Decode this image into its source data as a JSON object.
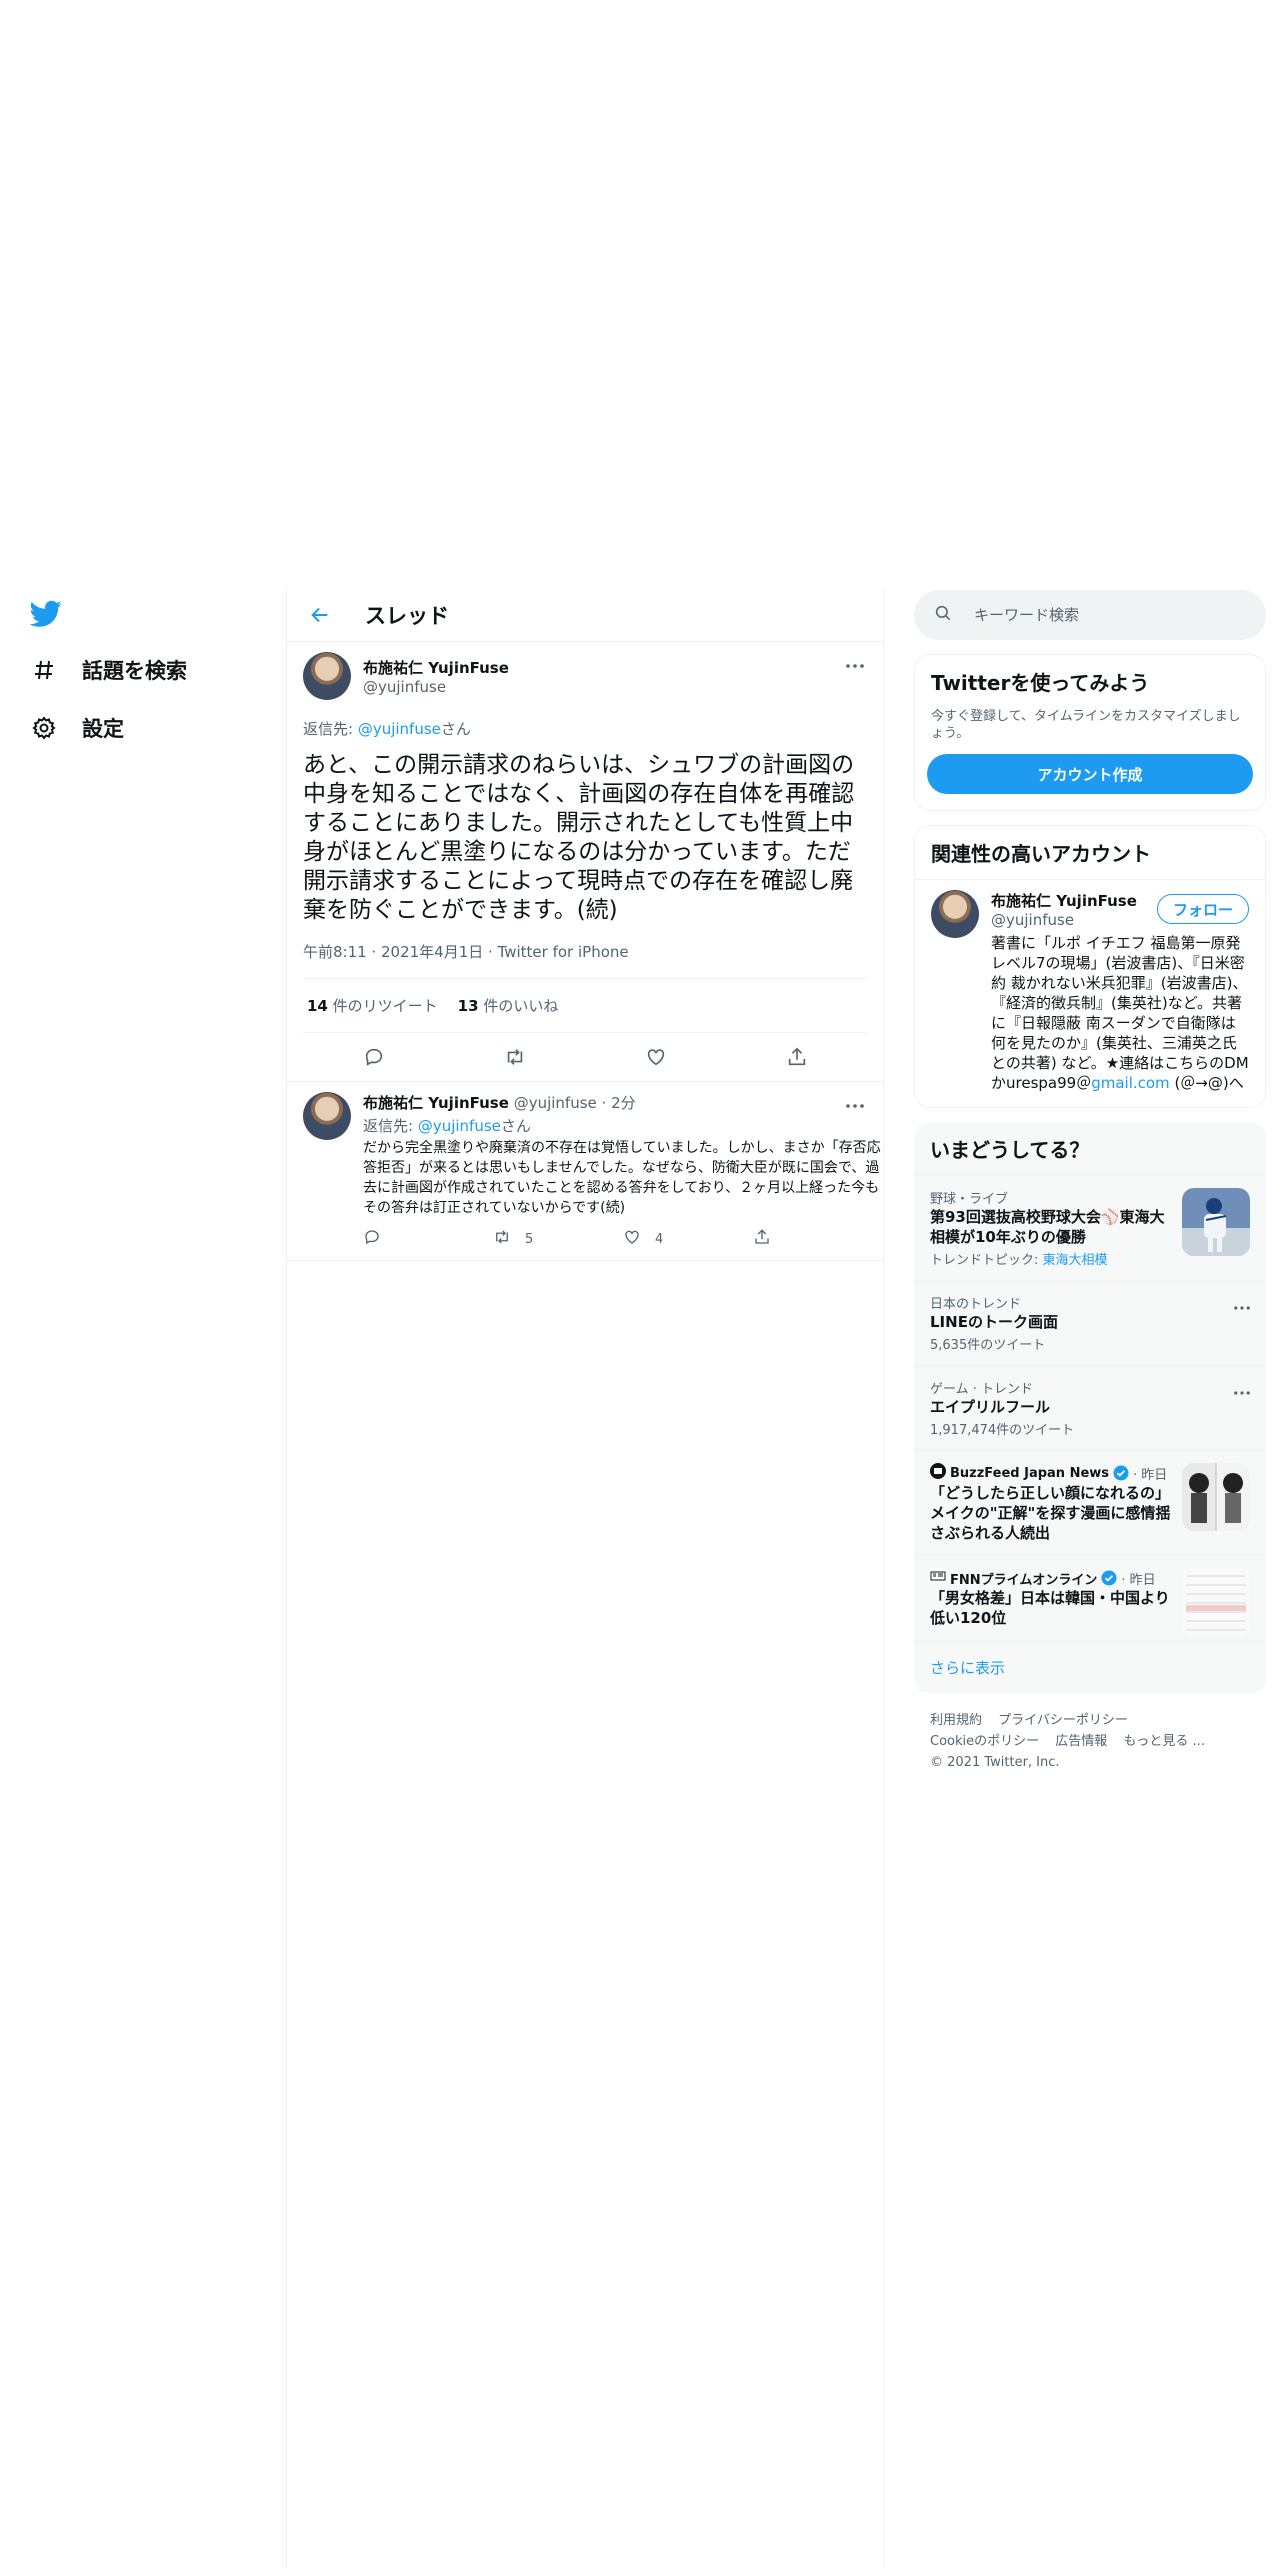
{
  "nav": {
    "explore_label": "話題を検索",
    "settings_label": "設定"
  },
  "header": {
    "title": "スレッド"
  },
  "main_tweet": {
    "display_name": "布施祐仁 YujinFuse",
    "username": "@yujinfuse",
    "replying_prefix": "返信先: ",
    "replying_handle": "@yujinfuse",
    "replying_suffix": "さん",
    "text": "あと、この開示請求のねらいは、シュワブの計画図の中身を知ることではなく、計画図の存在自体を再確認することにありました。開示されたとしても性質上中身がほとんど黒塗りになるのは分かっています。ただ開示請求することによって現時点での存在を確認し廃棄を防ぐことができます。(続)",
    "meta": "午前8:11 · 2021年4月1日 · Twitter for iPhone",
    "retweets": "14",
    "retweets_label": "件のリツイート",
    "likes": "13",
    "likes_label": "件のいいね"
  },
  "reply_tweet": {
    "display_name": "布施祐仁 YujinFuse",
    "meta": "@yujinfuse · 2分",
    "replying_prefix": "返信先: ",
    "replying_handle": "@yujinfuse",
    "replying_suffix": "さん",
    "text": "だから完全黒塗りや廃棄済の不存在は覚悟していました。しかし、まさか「存否応答拒否」が来るとは思いもしませんでした。なぜなら、防衛大臣が既に国会で、過去に計画図が作成されていたことを認める答弁をしており、２ヶ月以上経った今もその答弁は訂正されていないからです(続)",
    "retweets": "5",
    "likes": "4"
  },
  "search": {
    "placeholder": "キーワード検索"
  },
  "signup": {
    "title": "Twitterを使ってみよう",
    "desc": "今すぐ登録して、タイムラインをカスタマイズしましょう。",
    "button": "アカウント作成"
  },
  "related": {
    "title": "関連性の高いアカウント",
    "display_name": "布施祐仁 YujinFuse",
    "username": "@yujinfuse",
    "follow": "フォロー",
    "bio_1": "著書に「ルポ イチエフ 福島第一原発レベル7の現場」(岩波書店)、『日米密約 裁かれない米兵犯罪』(岩波書店)、『経済的徴兵制』(集英社)など。共著に『日報隠蔽 南スーダンで自衛隊は何を見たのか』(集英社、三浦英之氏との共著) など。★連絡はこちらのDMかurespa99＠",
    "bio_link": "gmail.com",
    "bio_2": " (＠→@)へ"
  },
  "trends": {
    "title": "いまどうしてる？",
    "items": [
      {
        "cat": "野球・ライブ",
        "name": "第93回選抜高校野球大会⚾東海大相模が10年ぶりの優勝",
        "topic_prefix": "トレンドトピック: ",
        "topic": "東海大相模"
      },
      {
        "cat": "日本のトレンド",
        "name": "LINEのトーク画面",
        "count": "5,635件のツイート"
      },
      {
        "cat": "ゲーム · トレンド",
        "name": "エイプリルフール",
        "count": "1,917,474件のツイート"
      },
      {
        "source": "BuzzFeed Japan News",
        "time": " · 昨日",
        "name": "「どうしたら正しい顔になれるの」メイクの\"正解\"を探す漫画に感情揺さぶられる人続出"
      },
      {
        "source": "FNNプライムオンライン",
        "time": " · 昨日",
        "name": "「男女格差」日本は韓国・中国より低い120位"
      }
    ],
    "show_more": "さらに表示"
  },
  "footer": {
    "links": [
      "利用規約",
      "プライバシーポリシー",
      "Cookieのポリシー",
      "広告情報",
      "もっと見る ..."
    ],
    "copyright": "© 2021 Twitter, Inc."
  },
  "colors": {
    "accent": "#1d9bf0",
    "text": "#0f1419",
    "muted": "#536471",
    "border": "#eff3f4"
  }
}
